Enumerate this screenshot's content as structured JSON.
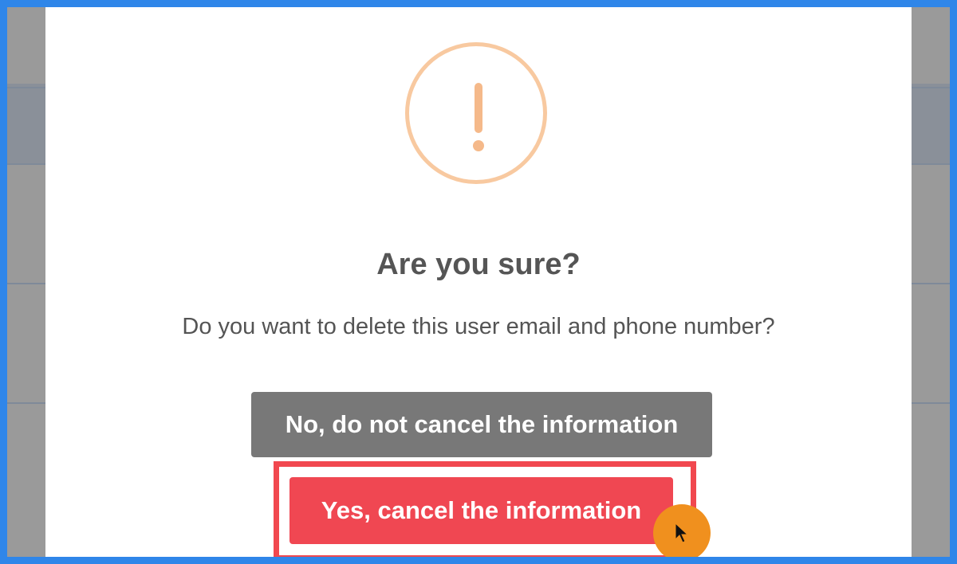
{
  "dialog": {
    "icon": "exclamation-warning-icon",
    "title": "Are you sure?",
    "message": "Do you want to delete this user email and phone number?",
    "cancel_button_label": "No, do not cancel the information",
    "confirm_button_label": "Yes, cancel the information"
  },
  "colors": {
    "frame_border": "#2f86e9",
    "warning_icon": "#f5b98a",
    "cancel_button": "#787878",
    "confirm_button": "#f04752",
    "highlight": "#f1484f",
    "cursor_badge": "#f0901e"
  },
  "cursor": {
    "icon": "mouse-pointer-icon"
  }
}
